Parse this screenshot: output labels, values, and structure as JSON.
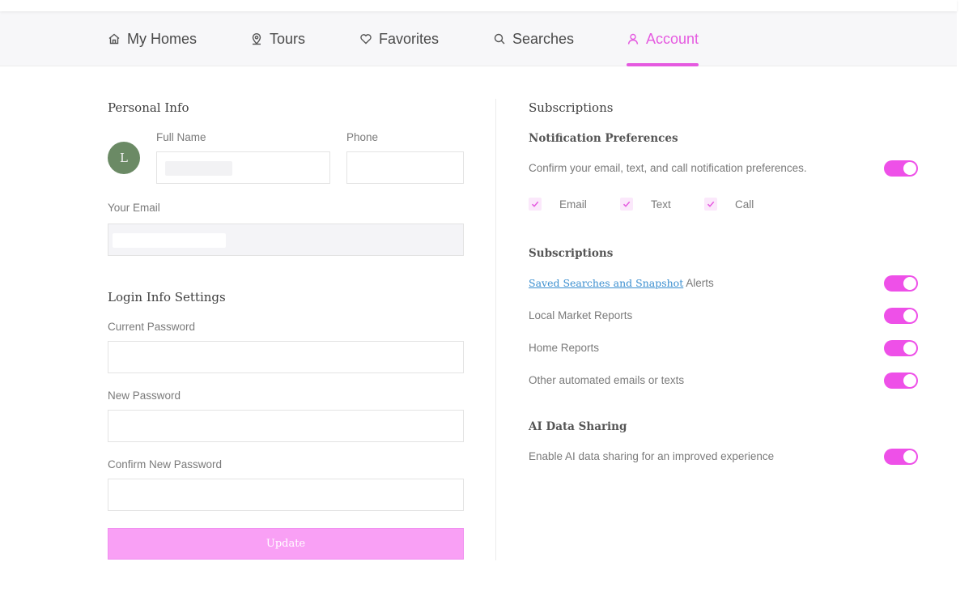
{
  "nav": {
    "items": [
      {
        "label": "My Homes",
        "icon": "home-icon"
      },
      {
        "label": "Tours",
        "icon": "tour-pin-icon"
      },
      {
        "label": "Favorites",
        "icon": "heart-icon"
      },
      {
        "label": "Searches",
        "icon": "search-icon"
      },
      {
        "label": "Account",
        "icon": "user-icon"
      }
    ],
    "active": "Account",
    "accent_color": "#e55ae0"
  },
  "personal_info": {
    "title": "Personal Info",
    "avatar_initial": "L",
    "full_name_label": "Full Name",
    "phone_label": "Phone",
    "email_label": "Your Email"
  },
  "login_info": {
    "title": "Login Info Settings",
    "current_password_label": "Current Password",
    "new_password_label": "New Password",
    "confirm_password_label": "Confirm New Password",
    "update_label": "Update"
  },
  "subscriptions_panel": {
    "title": "Subscriptions",
    "notification_title": "Notification Preferences",
    "notification_text": "Confirm your email, text, and call notification preferences.",
    "notification_enabled": true,
    "channels": [
      {
        "label": "Email",
        "checked": true
      },
      {
        "label": "Text",
        "checked": true
      },
      {
        "label": "Call",
        "checked": true
      }
    ],
    "subscriptions_title": "Subscriptions",
    "saved_searches_link": "Saved Searches and Snapshot",
    "saved_searches_suffix": "Alerts",
    "items": [
      {
        "label": "Local Market Reports",
        "enabled": true
      },
      {
        "label": "Home Reports",
        "enabled": true
      },
      {
        "label": "Other automated emails or texts",
        "enabled": true
      }
    ],
    "ai_title": "AI Data Sharing",
    "ai_text": "Enable AI data sharing for an improved experience",
    "ai_enabled": true,
    "toggle_color": "#ee50e8"
  }
}
